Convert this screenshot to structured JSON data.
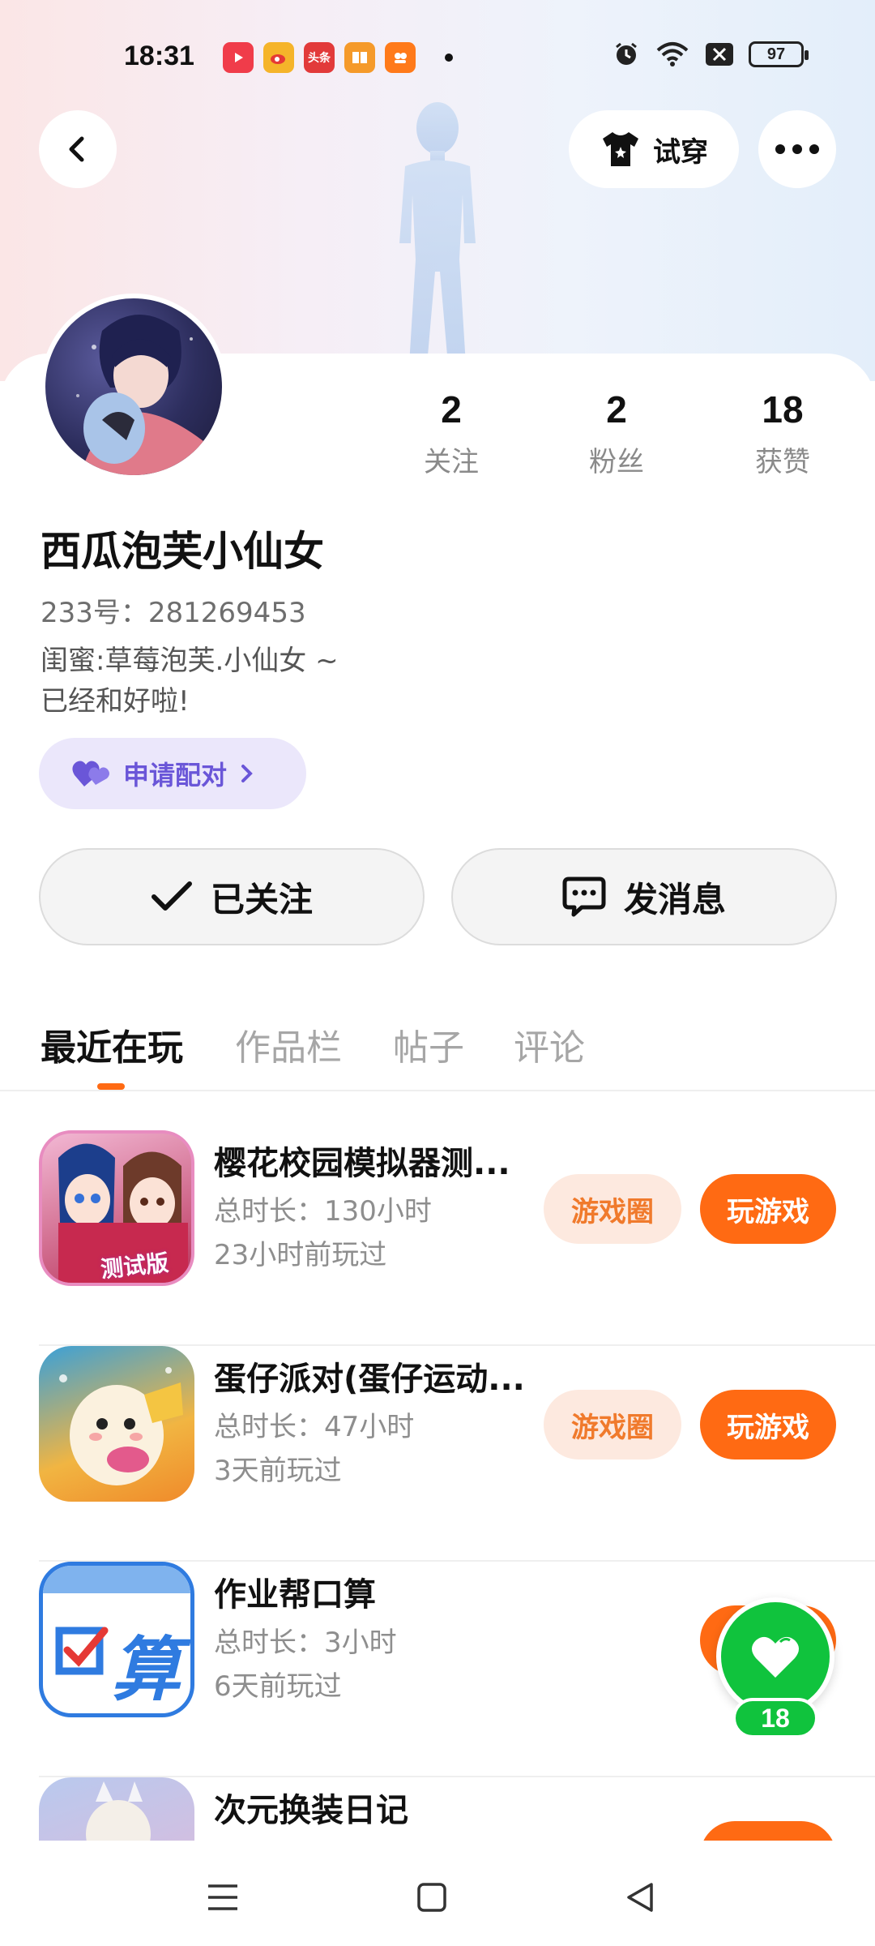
{
  "status_bar": {
    "time": "18:31",
    "battery": "97",
    "apps": [
      {
        "icon": "video-app-icon",
        "color": "#f03c4a"
      },
      {
        "icon": "weibo-app-icon",
        "color": "#f5b42a"
      },
      {
        "icon": "toutiao-app-icon",
        "color": "#e23a3a",
        "label": "头条"
      },
      {
        "icon": "reader-app-icon",
        "color": "#f59a2a"
      },
      {
        "icon": "mall-app-icon",
        "color": "#ff7a1a"
      }
    ]
  },
  "header": {
    "tryon_label": "试穿"
  },
  "profile": {
    "stats": [
      {
        "value": "2",
        "label": "关注"
      },
      {
        "value": "2",
        "label": "粉丝"
      },
      {
        "value": "18",
        "label": "获赞"
      }
    ],
    "username": "西瓜泡芙小仙女",
    "user_id": "233号：281269453",
    "bio_lines": [
      "闺蜜:草莓泡芙.小仙女 ~",
      "已经和好啦!"
    ],
    "pair_label": "申请配对",
    "follow_label": "已关注",
    "message_label": "发消息"
  },
  "tabs": [
    "最近在玩",
    "作品栏",
    "帖子",
    "评论"
  ],
  "games": [
    {
      "title": "樱花校园模拟器测...",
      "duration": "总时长：130小时",
      "last_played": "23小时前玩过",
      "circle_label": "游戏圈",
      "play_label": "玩游戏",
      "icon_badge": "测试版"
    },
    {
      "title": "蛋仔派对(蛋仔运动...",
      "duration": "总时长：47小时",
      "last_played": "3天前玩过",
      "circle_label": "游戏圈",
      "play_label": "玩游戏"
    },
    {
      "title": "作业帮口算",
      "duration": "总时长：3小时",
      "last_played": "6天前玩过",
      "icon_text": "算"
    },
    {
      "title": "次元换装日记"
    }
  ],
  "like_fab": {
    "count": "18"
  },
  "colors": {
    "accent": "#ff6a13",
    "purple": "#6a56d8",
    "green": "#10c33d"
  }
}
